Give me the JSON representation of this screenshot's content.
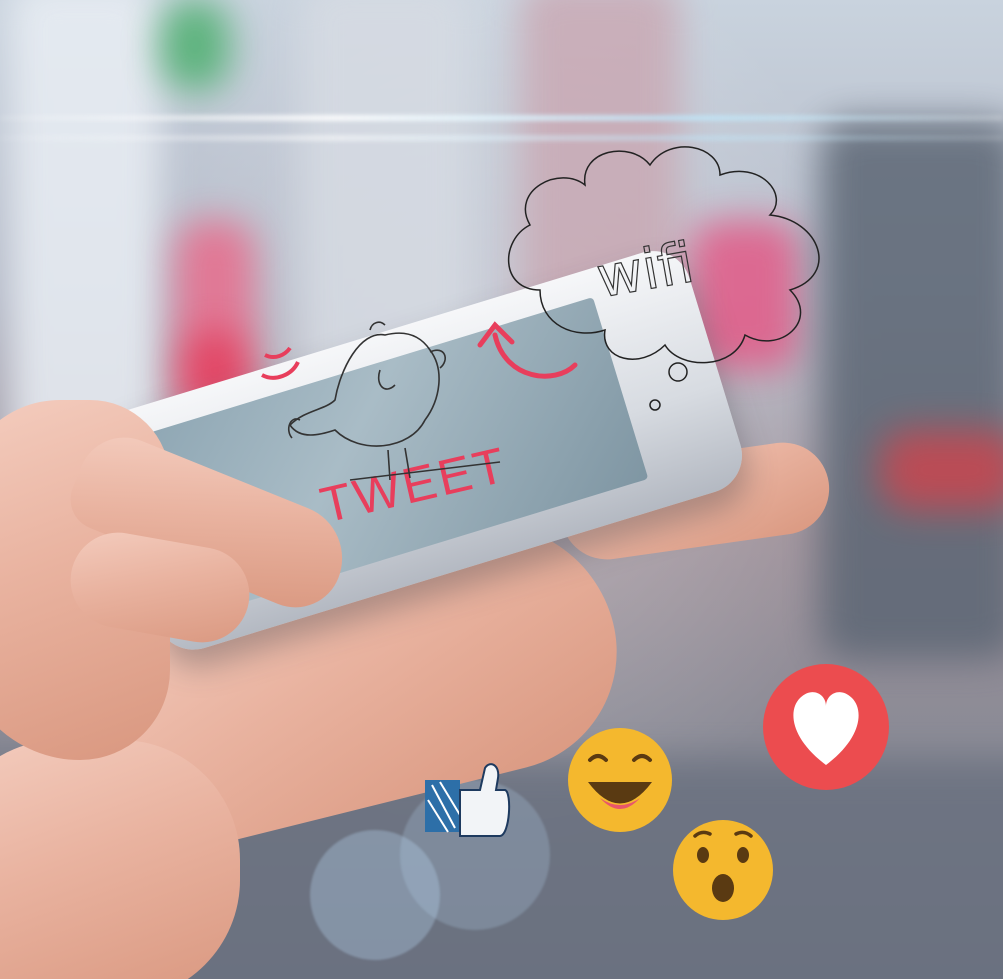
{
  "scene": {
    "phone_text": "TWEET",
    "cloud_text": "wifi"
  },
  "icons": {
    "bird": "bird-doodle-icon",
    "cloud": "thought-cloud-icon",
    "arrow": "curved-arrow-icon",
    "like": "thumbs-up-icon",
    "laugh": "laughing-emoji-icon",
    "wow": "surprised-emoji-icon",
    "heart": "heart-icon"
  },
  "colors": {
    "accent": "#e83e5c",
    "emoji_yellow": "#f4b82e",
    "heart_red": "#ec4c4f",
    "like_blue": "#2d6fa8"
  }
}
